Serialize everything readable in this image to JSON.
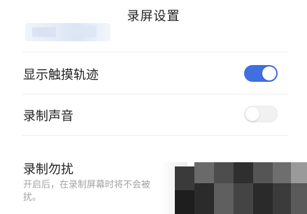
{
  "header": {
    "title": "录屏设置"
  },
  "settings": [
    {
      "label": "显示触摸轨迹",
      "enabled": true
    },
    {
      "label": "录制声音",
      "enabled": false
    },
    {
      "label": "录制勿扰"
    }
  ],
  "dnd": {
    "description_line1": "开启后，在录制屏幕时将不会被",
    "description_line2": "扰。"
  },
  "colors": {
    "accent": "#3f6fe0",
    "text": "#222222",
    "secondary_text": "#a3a3a3"
  }
}
